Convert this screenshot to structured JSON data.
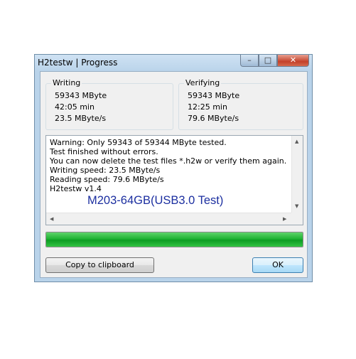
{
  "window": {
    "title": "H2testw | Progress",
    "minimize_glyph": "–",
    "maximize_glyph": "□",
    "close_glyph": "✕"
  },
  "writing": {
    "label": "Writing",
    "size": "59343 MByte",
    "time": "42:05 min",
    "speed": "23.5 MByte/s"
  },
  "verifying": {
    "label": "Verifying",
    "size": "59343 MByte",
    "time": "12:25 min",
    "speed": "79.6 MByte/s"
  },
  "log": {
    "lines": [
      "Warning: Only 59343 of 59344 MByte tested.",
      "Test finished without errors.",
      "You can now delete the test files *.h2w or verify them again.",
      "Writing speed: 23.5 MByte/s",
      "Reading speed: 79.6 MByte/s",
      "H2testw v1.4"
    ],
    "overlay_text": "M203-64GB(USB3.0 Test)"
  },
  "progress": {
    "fraction": 1.0,
    "color": "#1fb233"
  },
  "buttons": {
    "copy_label": "Copy to clipboard",
    "ok_label": "OK"
  },
  "icons": {
    "scroll_up": "scroll-up-arrow",
    "scroll_down": "scroll-down-arrow",
    "scroll_left": "scroll-left-arrow",
    "scroll_right": "scroll-right-arrow"
  }
}
